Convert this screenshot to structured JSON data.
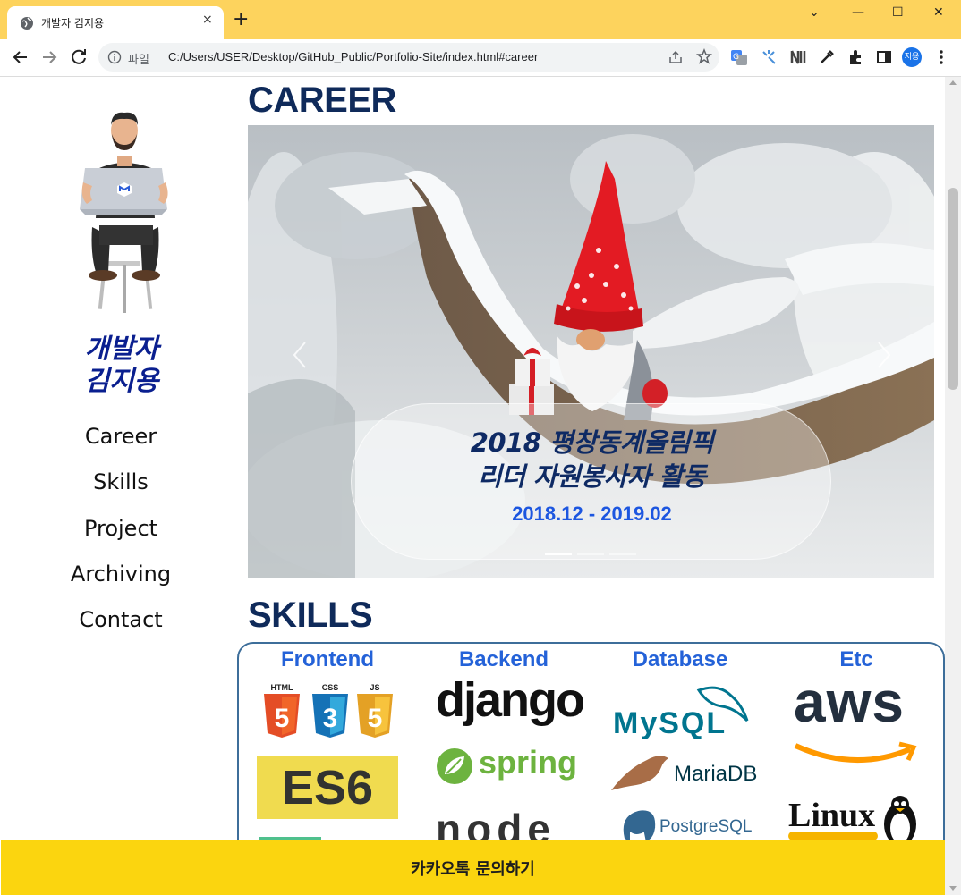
{
  "browser": {
    "tab_title": "개발자 김지용",
    "tab_close": "×",
    "new_tab": "+",
    "window_controls": [
      "⌄",
      "—",
      "☐",
      "✕"
    ],
    "scheme_label": "파일",
    "url": "C:/Users/USER/Desktop/GitHub_Public/Portfolio-Site/index.html#career",
    "profile_initials": "지용"
  },
  "sidebar": {
    "brand_line1": "개발자",
    "brand_line2": "김지용",
    "nav": [
      "Career",
      "Skills",
      "Project",
      "Archiving",
      "Contact"
    ]
  },
  "career": {
    "title": "CAREER",
    "slide_title_line1": "2018 평창동계올림픽",
    "slide_title_line2": "리더 자원봉사자 활동",
    "slide_date": "2018.12 - 2019.02",
    "slide_count": 3,
    "active_slide": 1
  },
  "skills": {
    "title": "SKILLS",
    "columns": [
      {
        "title": "Frontend",
        "logos": [
          "HTML",
          "CSS",
          "JS",
          "ES6"
        ]
      },
      {
        "title": "Backend",
        "logos": [
          "django",
          "spring",
          "node"
        ]
      },
      {
        "title": "Database",
        "logos": [
          "MySQL",
          "MariaDB",
          "PostgreSQL"
        ]
      },
      {
        "title": "Etc",
        "logos": [
          "aws",
          "Linux"
        ]
      }
    ]
  },
  "kakao": {
    "label": "카카오톡 문의하기"
  },
  "colors": {
    "tabbar": "#fdd35d",
    "brand": "#0a1f8f",
    "section_title": "#0f2a5a",
    "skill_heading": "#2462d8",
    "kakao": "#fbd50f"
  }
}
